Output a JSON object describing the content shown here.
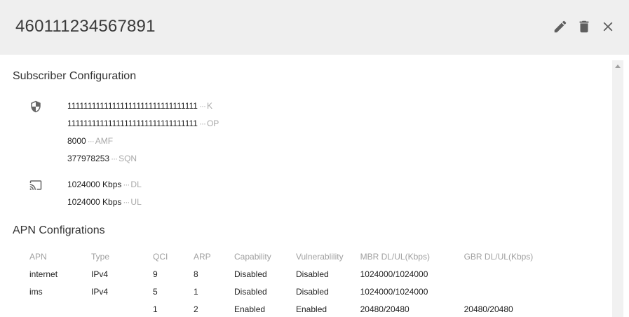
{
  "header": {
    "title": "460111234567891"
  },
  "icons": {
    "edit": "pencil-icon",
    "delete": "trash-icon",
    "close": "close-icon",
    "security": "shield-icon",
    "ambr": "cast-icon"
  },
  "subscriber": {
    "title": "Subscriber Configuration",
    "security": [
      {
        "value": "11111111111111111111111111111111",
        "key": "K"
      },
      {
        "value": "11111111111111111111111111111111",
        "key": "OP"
      },
      {
        "value": "8000",
        "key": "AMF"
      },
      {
        "value": "377978253",
        "key": "SQN"
      }
    ],
    "ambr": [
      {
        "value": "1024000 Kbps",
        "key": "DL"
      },
      {
        "value": "1024000 Kbps",
        "key": "UL"
      }
    ],
    "separator": "···"
  },
  "apn": {
    "title": "APN Configrations",
    "columns": [
      "APN",
      "Type",
      "QCI",
      "ARP",
      "Capability",
      "Vulnerablility",
      "MBR DL/UL(Kbps)",
      "GBR DL/UL(Kbps)"
    ],
    "rows": [
      [
        "internet",
        "IPv4",
        "9",
        "8",
        "Disabled",
        "Disabled",
        "1024000/1024000",
        ""
      ],
      [
        "ims",
        "IPv4",
        "5",
        "1",
        "Disabled",
        "Disabled",
        "1024000/1024000",
        ""
      ],
      [
        "",
        "",
        "1",
        "2",
        "Enabled",
        "Enabled",
        "20480/20480",
        "20480/20480"
      ]
    ]
  }
}
